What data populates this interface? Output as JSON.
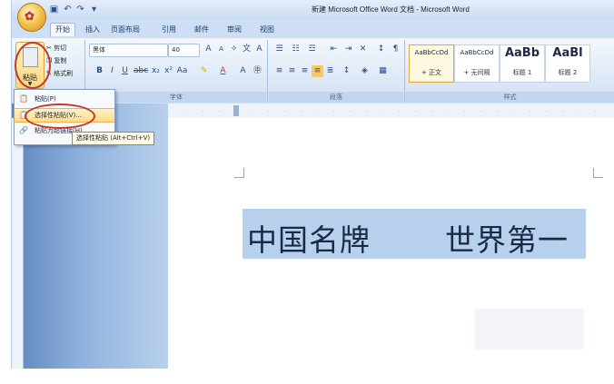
{
  "window": {
    "title": "新建 Microsoft Office Word 文档 - Microsoft Word"
  },
  "quick_access": [
    "save-icon",
    "undo-icon",
    "redo-icon",
    "customize-icon"
  ],
  "tabs": [
    {
      "label": "开始",
      "active": true
    },
    {
      "label": "插入"
    },
    {
      "label": "页面布局"
    },
    {
      "label": "引用"
    },
    {
      "label": "邮件"
    },
    {
      "label": "审阅"
    },
    {
      "label": "视图"
    }
  ],
  "ribbon": {
    "clipboard": {
      "paste_label": "粘贴",
      "cut_label": "剪切",
      "copy_label": "复制",
      "format_painter_label": "格式刷"
    },
    "font": {
      "group_label": "字体",
      "font_name": "黑体",
      "font_size": "40"
    },
    "paragraph": {
      "group_label": "段落"
    },
    "styles": {
      "group_label": "样式",
      "items": [
        {
          "sample": "AaBbCcDd",
          "name": "+ 正文"
        },
        {
          "sample": "AaBbCcDd",
          "name": "+ 无间隔"
        },
        {
          "sample": "AaBb",
          "name": "标题 1"
        },
        {
          "sample": "AaBl",
          "name": "标题 2"
        }
      ]
    }
  },
  "paste_menu": {
    "items": [
      {
        "label": "粘贴(P)"
      },
      {
        "label": "选择性粘贴(V)..."
      },
      {
        "label": "粘贴为超链接(H)"
      }
    ]
  },
  "tooltip": "选择性粘贴 (Alt+Ctrl+V)",
  "document": {
    "line_left": "中国名牌",
    "line_right": "世界第一"
  },
  "colors": {
    "accent": "#c0392b",
    "selection": "#b7d0ec",
    "ribbon": "#dbe7f6"
  }
}
